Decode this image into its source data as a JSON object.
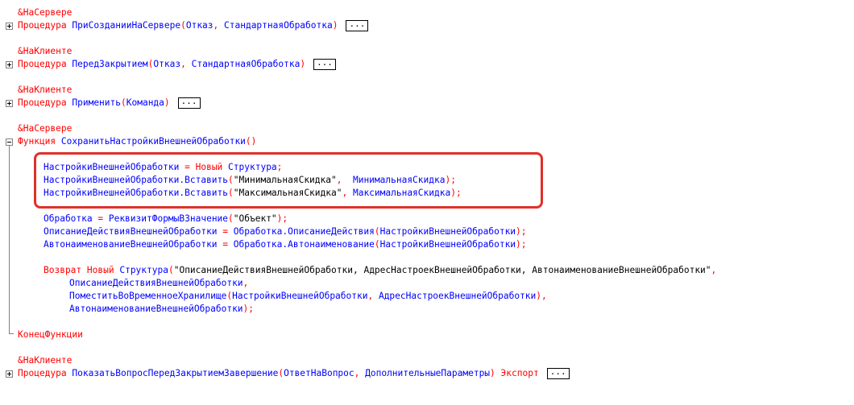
{
  "code": {
    "block1": {
      "directive": "&НаСервере",
      "keyword": "Процедура",
      "name": "ПриСозданииНаСервере",
      "params": [
        "Отказ",
        "СтандартнаяОбработка"
      ],
      "collapsed": "..."
    },
    "block2": {
      "directive": "&НаКлиенте",
      "keyword": "Процедура",
      "name": "ПередЗакрытием",
      "params": [
        "Отказ",
        "СтандартнаяОбработка"
      ],
      "collapsed": "..."
    },
    "block3": {
      "directive": "&НаКлиенте",
      "keyword": "Процедура",
      "name": "Применить",
      "params": [
        "Команда"
      ],
      "collapsed": "..."
    },
    "block4": {
      "directive": "&НаСервере",
      "keyword": "Функция",
      "name": "СохранитьНастройкиВнешнейОбработки",
      "highlighted": [
        {
          "var": "НастройкиВнешнейОбработки",
          "eq": " = ",
          "kw": "Новый",
          "cls": "Структура"
        },
        {
          "var": "НастройкиВнешнейОбработки",
          "method": ".Вставить",
          "str": "\"МинимальнаяСкидка\"",
          "sep": ",  ",
          "arg": "МинимальнаяСкидка"
        },
        {
          "var": "НастройкиВнешнейОбработки",
          "method": ".Вставить",
          "str": "\"МаксимальнаяСкидка\"",
          "sep": ", ",
          "arg": "МаксимальнаяСкидка"
        }
      ],
      "assign1": {
        "var": "Обработка",
        "eq": " = ",
        "fn": "РеквизитФормыВЗначение",
        "str": "\"Объект\""
      },
      "assign2": {
        "var": "ОписаниеДействияВнешнейОбработки",
        "eq": " = ",
        "obj": "Обработка",
        "prop": ".ОписаниеДействия",
        "arg": "НастройкиВнешнейОбработки"
      },
      "assign3": {
        "var": "АвтонаименованиеВнешнейОбработки",
        "eq": " = ",
        "obj": "Обработка",
        "prop": ".Автонаименование",
        "arg": "НастройкиВнешнейОбработки"
      },
      "ret": {
        "kw1": "Возврат",
        "kw2": "Новый",
        "cls": "Структура",
        "str": "\"ОписаниеДействияВнешнейОбработки, АдресНастроекВнешнейОбработки, АвтонаименованиеВнешнейОбработки\"",
        "arg1": "ОписаниеДействияВнешнейОбработки",
        "fn": "ПоместитьВоВременноеХранилище",
        "fn_arg1": "НастройкиВнешнейОбработки",
        "fn_arg2": "АдресНастроекВнешнейОбработки",
        "arg3": "АвтонаименованиеВнешнейОбработки"
      },
      "end": "КонецФункции"
    },
    "block5": {
      "directive": "&НаКлиенте",
      "keyword": "Процедура",
      "name": "ПоказатьВопросПередЗакрытиемЗавершение",
      "params": [
        "ОтветНаВопрос",
        "ДополнительныеПараметры"
      ],
      "export": "Экспорт",
      "collapsed": "..."
    }
  }
}
